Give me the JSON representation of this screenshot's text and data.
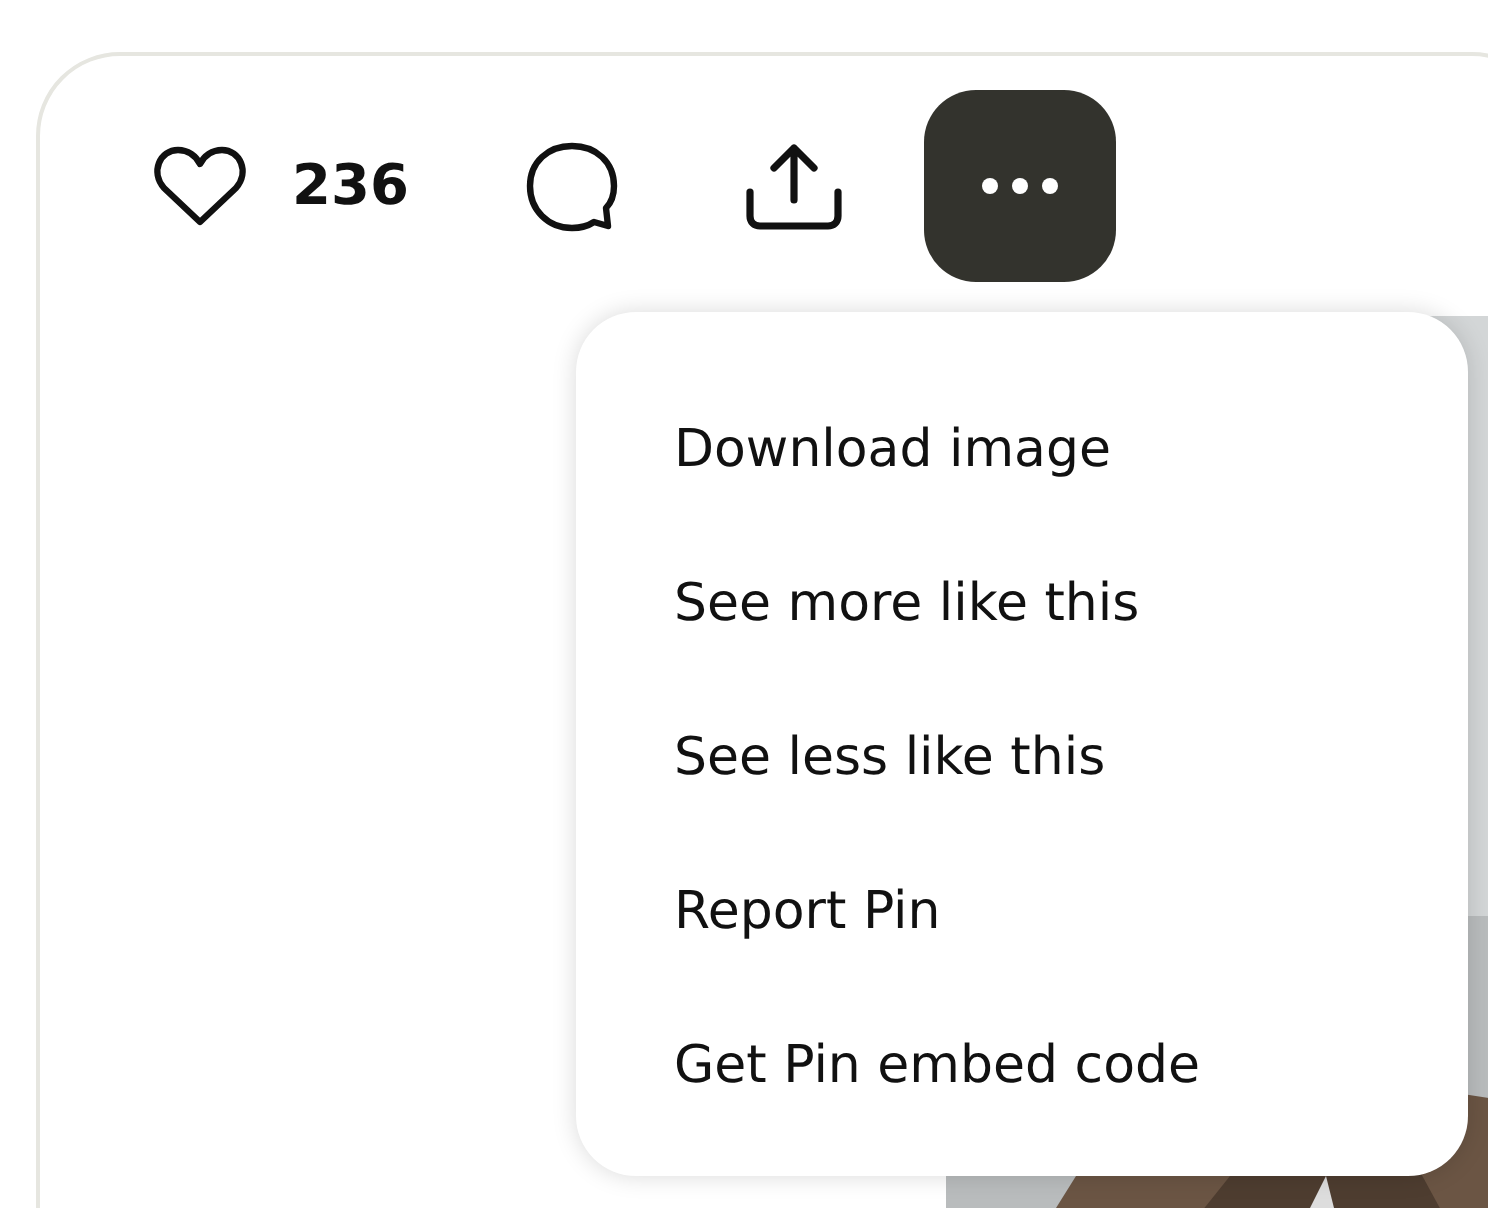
{
  "toolbar": {
    "like_count": "236",
    "more_button": {
      "expanded": true
    }
  },
  "menu": {
    "items": [
      {
        "label": "Download image"
      },
      {
        "label": "See more like this"
      },
      {
        "label": "See less like this"
      },
      {
        "label": "Report Pin"
      },
      {
        "label": "Get Pin embed code"
      }
    ]
  }
}
